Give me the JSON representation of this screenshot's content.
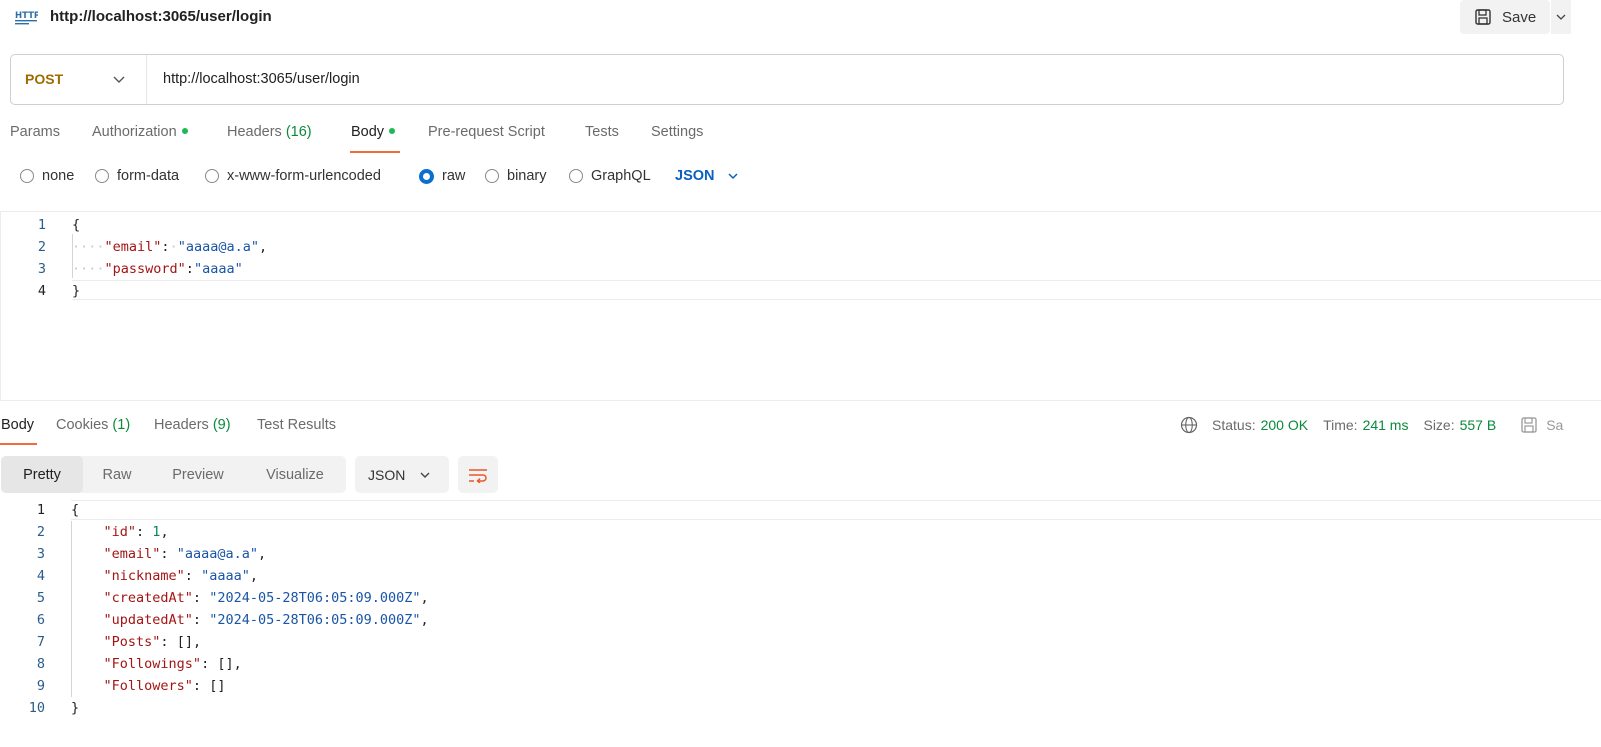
{
  "request": {
    "title": "http://localhost:3065/user/login",
    "save_label": "Save",
    "method": "POST",
    "url": "http://localhost:3065/user/login"
  },
  "request_tabs": [
    {
      "label": "Params"
    },
    {
      "label": "Authorization",
      "dot": true
    },
    {
      "label": "Headers",
      "count": "(16)"
    },
    {
      "label": "Body",
      "dot": true,
      "active": true
    },
    {
      "label": "Pre-request Script"
    },
    {
      "label": "Tests"
    },
    {
      "label": "Settings"
    }
  ],
  "body_types": [
    {
      "label": "none",
      "selected": false
    },
    {
      "label": "form-data",
      "selected": false
    },
    {
      "label": "x-www-form-urlencoded",
      "selected": false
    },
    {
      "label": "raw",
      "selected": true
    },
    {
      "label": "binary",
      "selected": false
    },
    {
      "label": "GraphQL",
      "selected": false
    }
  ],
  "raw_format": "JSON",
  "request_body": {
    "line_numbers": [
      "1",
      "2",
      "3",
      "4"
    ],
    "open": "{",
    "close": "}",
    "email_key": "\"email\"",
    "email_value": "\"aaaa@a.a\"",
    "password_key": "\"password\"",
    "password_value": "\"aaaa\""
  },
  "response_tabs": [
    {
      "label": "Body",
      "active": true
    },
    {
      "label": "Cookies",
      "count": "(1)"
    },
    {
      "label": "Headers",
      "count": "(9)"
    },
    {
      "label": "Test Results"
    }
  ],
  "status": {
    "status_label": "Status:",
    "status_value": "200 OK",
    "time_label": "Time:",
    "time_value": "241 ms",
    "size_label": "Size:",
    "size_value": "557 B",
    "save_response_label": "Sa"
  },
  "response_views": [
    "Pretty",
    "Raw",
    "Preview",
    "Visualize"
  ],
  "response_format": "JSON",
  "response_body": {
    "line_numbers": [
      "1",
      "2",
      "3",
      "4",
      "5",
      "6",
      "7",
      "8",
      "9",
      "10"
    ],
    "open": "{",
    "close": "}",
    "fields": [
      {
        "key": "\"id\"",
        "value": "1",
        "type": "num",
        "comma": ","
      },
      {
        "key": "\"email\"",
        "value": "\"aaaa@a.a\"",
        "type": "str",
        "comma": ","
      },
      {
        "key": "\"nickname\"",
        "value": "\"aaaa\"",
        "type": "str",
        "comma": ","
      },
      {
        "key": "\"createdAt\"",
        "value": "\"2024-05-28T06:05:09.000Z\"",
        "type": "str",
        "comma": ","
      },
      {
        "key": "\"updatedAt\"",
        "value": "\"2024-05-28T06:05:09.000Z\"",
        "type": "str",
        "comma": ","
      },
      {
        "key": "\"Posts\"",
        "value": "[]",
        "type": "plain",
        "comma": ","
      },
      {
        "key": "\"Followings\"",
        "value": "[]",
        "type": "plain",
        "comma": ","
      },
      {
        "key": "\"Followers\"",
        "value": "[]",
        "type": "plain",
        "comma": ""
      }
    ]
  },
  "colors": {
    "accent_underline": "#f26b3a",
    "method_post": "#a06b00",
    "status_green": "#0a8a3a",
    "json_key": "#a31515",
    "json_string": "#1a55a6",
    "json_number": "#098658"
  }
}
